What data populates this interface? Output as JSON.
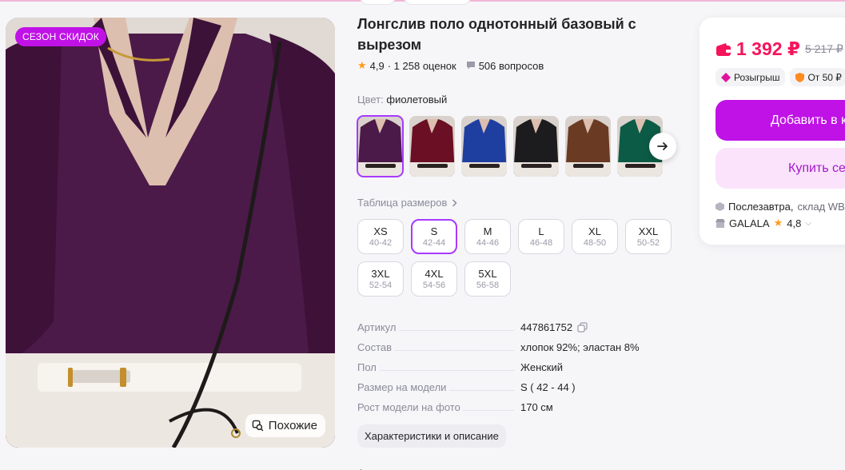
{
  "product": {
    "title": "Лонгслив поло однотонный базовый с вырезом",
    "badge": "СЕЗОН СКИДОК",
    "similar_label": "Похожие",
    "rating": "4,9",
    "reviews": "· 1 258 оценок",
    "questions": "506 вопросов"
  },
  "color": {
    "label": "Цвет:",
    "value": "фиолетовый",
    "thumbs": [
      {
        "name": "purple",
        "hex": "#4b1a48"
      },
      {
        "name": "burgundy",
        "hex": "#6a0f24"
      },
      {
        "name": "blue",
        "hex": "#1f3fa0"
      },
      {
        "name": "black",
        "hex": "#1c1c1f"
      },
      {
        "name": "brown",
        "hex": "#6b3a23"
      },
      {
        "name": "green",
        "hex": "#0c5b46"
      }
    ]
  },
  "sizes": {
    "table_link": "Таблица размеров",
    "selected": "S",
    "items": [
      {
        "name": "XS",
        "range": "40-42"
      },
      {
        "name": "S",
        "range": "42-44"
      },
      {
        "name": "M",
        "range": "44-46"
      },
      {
        "name": "L",
        "range": "46-48"
      },
      {
        "name": "XL",
        "range": "48-50"
      },
      {
        "name": "XXL",
        "range": "50-52"
      },
      {
        "name": "3XL",
        "range": "52-54"
      },
      {
        "name": "4XL",
        "range": "54-56"
      },
      {
        "name": "5XL",
        "range": "56-58"
      }
    ]
  },
  "specs": [
    {
      "key": "Артикул",
      "value": "447861752"
    },
    {
      "key": "Состав",
      "value": "хлопок 92%; эластан 8%"
    },
    {
      "key": "Пол",
      "value": "Женский"
    },
    {
      "key": "Размер на модели",
      "value": "S ( 42 - 44 )"
    },
    {
      "key": "Рост модели на фото",
      "value": "170 см"
    }
  ],
  "characteristics_button": "Характеристики и описание",
  "back_arrow": "←",
  "buy": {
    "price": "1 392 ₽",
    "old_price": "5 217 ₽",
    "chip_raffle": "Розыгрыш",
    "chip_from": "От 50 ₽",
    "add_to_cart": "Добавить в корзину",
    "buy_now": "Купить сейчас",
    "delivery_when": "Послезавтра,",
    "delivery_where": "склад WB",
    "seller_name": "GALALA",
    "seller_rating": "4,8"
  },
  "colors": {
    "accent": "#c012e6",
    "selected_outline": "#a73afd",
    "price": "#f5145b",
    "star": "#ff9b1a"
  }
}
